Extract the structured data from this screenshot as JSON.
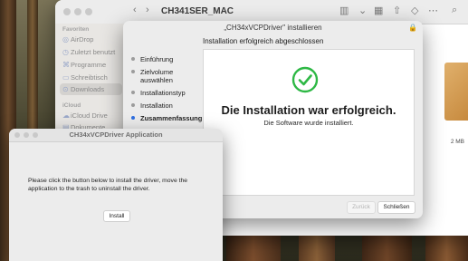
{
  "finder": {
    "title": "CH341SER_MAC",
    "sidebar_favorites_heading": "Favoriten",
    "sidebar_icloud_heading": "iCloud",
    "favorites": [
      "AirDrop",
      "Zuletzt benutzt",
      "Programme",
      "Schreibtisch",
      "Downloads"
    ],
    "icloud_items": [
      "iCloud Drive",
      "Dokumente"
    ],
    "selected": "Downloads",
    "file_size": "2 MB"
  },
  "installer": {
    "title": "„CH34xVCPDriver\" installieren",
    "subtitle": "Installation erfolgreich abgeschlossen",
    "steps": [
      "Einführung",
      "Zielvolume auswählen",
      "Installationstyp",
      "Installation",
      "Zusammenfassung"
    ],
    "active_step": "Zusammenfassung",
    "success_heading": "Die Installation war erfolgreich.",
    "success_text": "Die Software wurde installiert.",
    "back_button": "Zurück",
    "close_button": "Schließen"
  },
  "app": {
    "title": "CH34xVCPDriver Application",
    "message": "Please click the button below to install the driver, move the application to the trash to uninstall the driver.",
    "install_button": "Install"
  },
  "colors": {
    "success_green": "#2eb845",
    "active_step_blue": "#2f6fe0"
  }
}
